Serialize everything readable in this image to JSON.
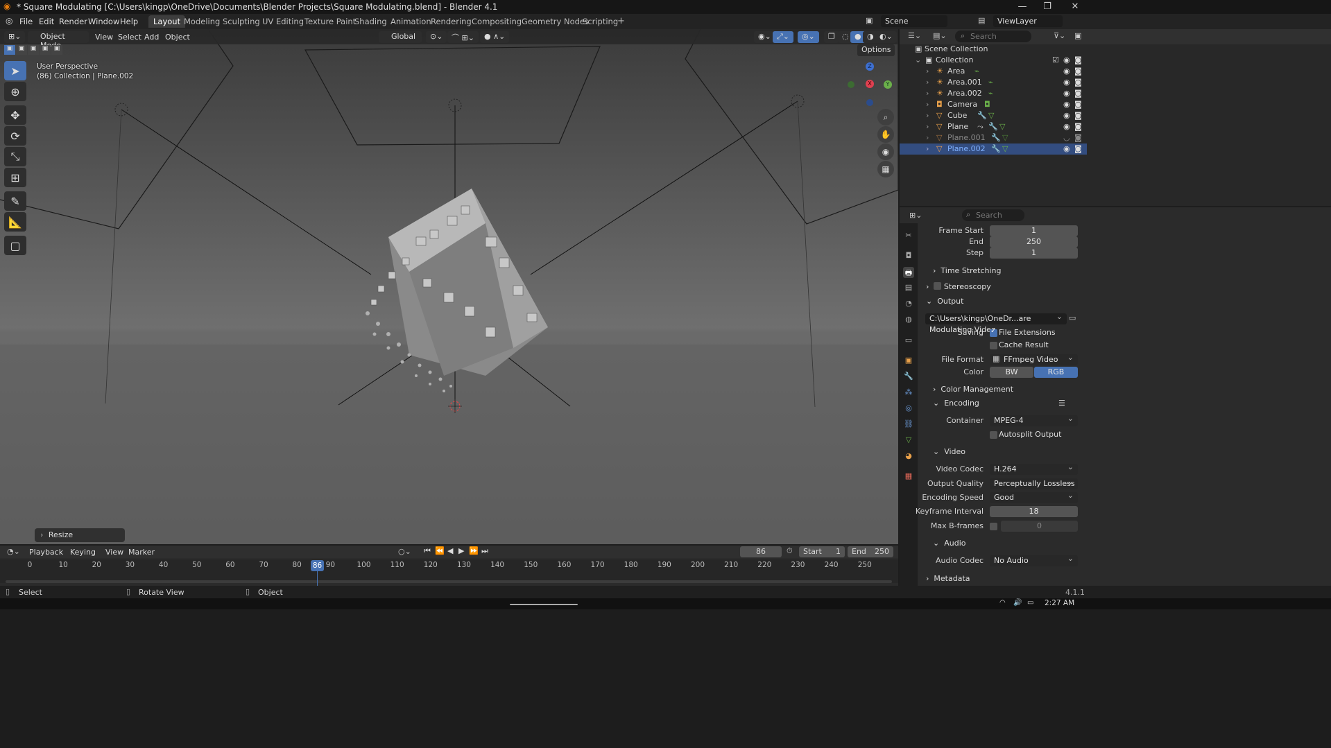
{
  "window": {
    "title": "* Square Modulating [C:\\Users\\kingp\\OneDrive\\Documents\\Blender Projects\\Square Modulating.blend] - Blender 4.1"
  },
  "menu": [
    "File",
    "Edit",
    "Render",
    "Window",
    "Help"
  ],
  "workspaces": [
    "Layout",
    "Modeling",
    "Sculpting",
    "UV Editing",
    "Texture Paint",
    "Shading",
    "Animation",
    "Rendering",
    "Compositing",
    "Geometry Nodes",
    "Scripting"
  ],
  "active_workspace": "Layout",
  "scene": {
    "scene_name": "Scene",
    "view_layer": "ViewLayer"
  },
  "viewport": {
    "mode": "Object Mode",
    "menus": [
      "View",
      "Select",
      "Add",
      "Object"
    ],
    "orientation": "Global",
    "options_label": "Options",
    "info_line1": "User Perspective",
    "info_line2": "(86) Collection | Plane.002",
    "resize_label": "Resize",
    "gizmo": {
      "x": "X",
      "y": "Y",
      "z": "Z"
    }
  },
  "outliner": {
    "search_placeholder": "Search",
    "root": "Scene Collection",
    "collection": "Collection",
    "items": [
      {
        "name": "Area",
        "type": "light"
      },
      {
        "name": "Area.001",
        "type": "light"
      },
      {
        "name": "Area.002",
        "type": "light"
      },
      {
        "name": "Camera",
        "type": "camera"
      },
      {
        "name": "Cube",
        "type": "mesh"
      },
      {
        "name": "Plane",
        "type": "mesh"
      },
      {
        "name": "Plane.001",
        "type": "mesh"
      },
      {
        "name": "Plane.002",
        "type": "mesh"
      }
    ],
    "selected": "Plane.002"
  },
  "properties": {
    "search_placeholder": "Search",
    "frame_start_label": "Frame Start",
    "frame_start": "1",
    "end_label": "End",
    "end": "250",
    "step_label": "Step",
    "step": "1",
    "time_stretching": "Time Stretching",
    "stereoscopy": "Stereoscopy",
    "output": "Output",
    "output_path": "C:\\Users\\kingp\\OneDr...are Modulating Video",
    "saving_label": "Saving",
    "file_extensions": "File Extensions",
    "cache_result": "Cache Result",
    "file_format_label": "File Format",
    "file_format": "FFmpeg Video",
    "color_label": "Color",
    "color_bw": "BW",
    "color_rgb": "RGB",
    "color_management": "Color Management",
    "encoding": "Encoding",
    "container_label": "Container",
    "container": "MPEG-4",
    "autosplit": "Autosplit Output",
    "video": "Video",
    "video_codec_label": "Video Codec",
    "video_codec": "H.264",
    "output_quality_label": "Output Quality",
    "output_quality": "Perceptually Lossless",
    "encoding_speed_label": "Encoding Speed",
    "encoding_speed": "Good",
    "keyframe_interval_label": "Keyframe Interval",
    "keyframe_interval": "18",
    "max_bframes_label": "Max B-frames",
    "max_bframes": "0",
    "audio": "Audio",
    "audio_codec_label": "Audio Codec",
    "audio_codec": "No Audio",
    "metadata": "Metadata"
  },
  "timeline": {
    "menus": [
      "Playback",
      "Keying",
      "View",
      "Marker"
    ],
    "current_frame": "86",
    "start_label": "Start",
    "start": "1",
    "end_label": "End",
    "end": "250",
    "ticks": [
      "0",
      "10",
      "20",
      "30",
      "40",
      "50",
      "60",
      "70",
      "80",
      "90",
      "100",
      "110",
      "120",
      "130",
      "140",
      "150",
      "160",
      "170",
      "180",
      "190",
      "200",
      "210",
      "220",
      "230",
      "240",
      "250"
    ]
  },
  "statusbar": {
    "select": "Select",
    "rotate": "Rotate View",
    "object": "Object",
    "version": "4.1.1"
  },
  "taskbar": {
    "time": "2:27 AM"
  }
}
